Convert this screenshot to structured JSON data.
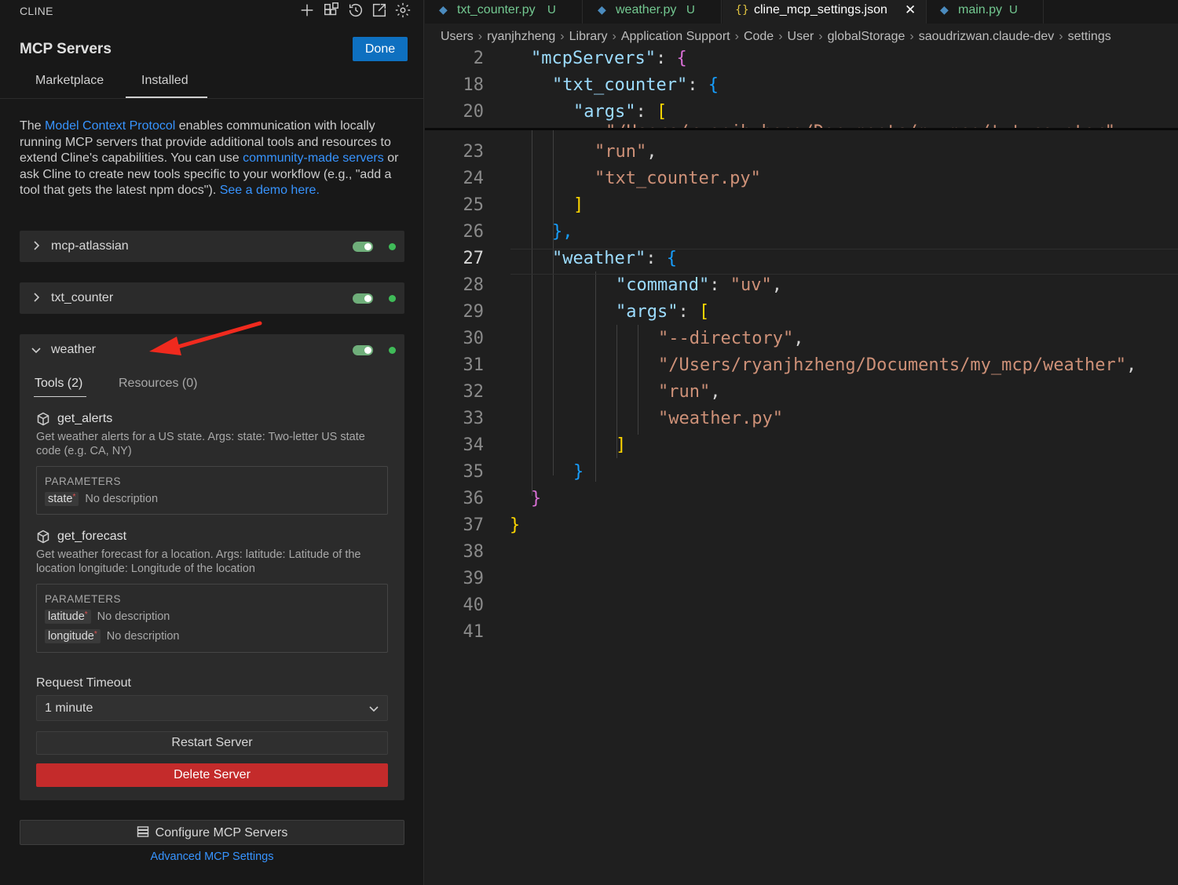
{
  "panel": {
    "title": "CLINE",
    "heading": "MCP Servers",
    "done_label": "Done",
    "tabs": {
      "marketplace": "Marketplace",
      "installed": "Installed"
    },
    "intro": {
      "t1": "The ",
      "l1": "Model Context Protocol",
      "t2": " enables communication with locally running MCP servers that provide additional tools and resources to extend Cline's capabilities. You can use ",
      "l2": "community-made servers",
      "t3": " or ask Cline to create new tools specific to your workflow (e.g., \"add a tool that gets the latest npm docs\"). ",
      "l3": "See a demo here."
    },
    "servers": [
      {
        "name": "mcp-atlassian",
        "enabled": true,
        "status": "connected",
        "expanded": false
      },
      {
        "name": "txt_counter",
        "enabled": true,
        "status": "connected",
        "expanded": false
      },
      {
        "name": "weather",
        "enabled": true,
        "status": "connected",
        "expanded": true
      }
    ],
    "weather": {
      "tools_tab": "Tools (2)",
      "resources_tab": "Resources (0)",
      "tools": [
        {
          "name": "get_alerts",
          "description": "Get weather alerts for a US state. Args: state: Two-letter US state code (e.g. CA, NY)",
          "params_title": "PARAMETERS",
          "params": [
            {
              "name": "state",
              "required": "*",
              "desc": "No description"
            }
          ]
        },
        {
          "name": "get_forecast",
          "description": "Get weather forecast for a location. Args: latitude: Latitude of the location longitude: Longitude of the location",
          "params_title": "PARAMETERS",
          "params": [
            {
              "name": "latitude",
              "required": "*",
              "desc": "No description"
            },
            {
              "name": "longitude",
              "required": "*",
              "desc": "No description"
            }
          ]
        }
      ],
      "timeout_label": "Request Timeout",
      "timeout_value": "1 minute",
      "restart_label": "Restart Server",
      "delete_label": "Delete Server"
    },
    "configure_label": "Configure MCP Servers",
    "advanced_label": "Advanced MCP Settings"
  },
  "editor": {
    "tabs": [
      {
        "name": "txt_counter.py",
        "flag": "U",
        "icon": "python-icon",
        "active": false
      },
      {
        "name": "weather.py",
        "flag": "U",
        "icon": "python-icon",
        "active": false
      },
      {
        "name": "cline_mcp_settings.json",
        "flag": "",
        "icon": "json-icon",
        "active": true
      },
      {
        "name": "main.py",
        "flag": "U",
        "icon": "python-icon",
        "active": false
      }
    ],
    "breadcrumbs": [
      "Users",
      "ryanjhzheng",
      "Library",
      "Application Support",
      "Code",
      "User",
      "globalStorage",
      "saoudrizwan.claude-dev",
      "settings"
    ],
    "lines": {
      "n2": "2",
      "n18": "18",
      "n20": "20",
      "n23": "23",
      "n24": "24",
      "n25": "25",
      "n26": "26",
      "n27": "27",
      "n28": "28",
      "n29": "29",
      "n30": "30",
      "n31": "31",
      "n32": "32",
      "n33": "33",
      "n34": "34",
      "n35": "35",
      "n36": "36",
      "n37": "37",
      "n38": "38",
      "n39": "39",
      "n40": "40",
      "n41": "41"
    },
    "code": {
      "mcpServers": "\"mcpServers\"",
      "txt_counter": "\"txt_counter\"",
      "args": "\"args\"",
      "cut": "\"/Users/ryanjhzheng/Documents/my_mcp/txt_counter\",",
      "run": "\"run\"",
      "txt_py": "\"txt_counter.py\"",
      "weather": "\"weather\"",
      "command": "\"command\"",
      "uv": "\"uv\"",
      "directory": "\"--directory\"",
      "weather_path": "\"/Users/ryanjhzheng/Documents/my_mcp/weather\"",
      "weather_py": "\"weather.py\"",
      "colon": ": ",
      "comma": ",",
      "lbrace": "{",
      "rbrace": "}",
      "lbrack": "[",
      "rbrack": "]",
      "rbrace_comma": "},"
    }
  },
  "colors": {
    "accent": "#0e70c0",
    "danger": "#c42b2b",
    "link": "#3794ff",
    "toggle_on": "#6fae7a",
    "status_ok": "#3fbb58"
  }
}
